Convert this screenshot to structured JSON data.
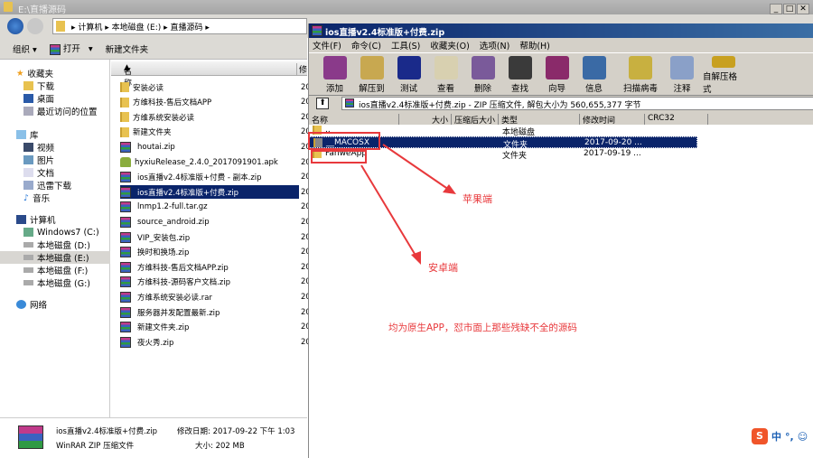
{
  "explorer": {
    "title": "E:\\直播源码",
    "breadcrumb": [
      "计算机",
      "本地磁盘 (E:)",
      "直播源码"
    ],
    "toolbar": {
      "organize": "组织",
      "open": "打开",
      "new_folder": "新建文件夹"
    },
    "sidebar": {
      "favorites": {
        "label": "收藏夹",
        "items": [
          "下载",
          "桌面",
          "最近访问的位置"
        ]
      },
      "libraries": {
        "label": "库",
        "items": [
          "视频",
          "图片",
          "文档",
          "迅雷下载",
          "音乐"
        ]
      },
      "computer": {
        "label": "计算机",
        "items": [
          "Windows7 (C:)",
          "本地磁盘 (D:)",
          "本地磁盘 (E:)",
          "本地磁盘 (F:)",
          "本地磁盘 (G:)"
        ]
      },
      "network": "网络"
    },
    "columns": {
      "name": "名称",
      "date": "修"
    },
    "files": [
      {
        "name": "安装必读",
        "type": "folder"
      },
      {
        "name": "方维科技-售后文档APP",
        "type": "folder"
      },
      {
        "name": "方维系统安装必读",
        "type": "folder"
      },
      {
        "name": "新建文件夹",
        "type": "folder"
      },
      {
        "name": "houtai.zip",
        "type": "rar"
      },
      {
        "name": "hyxiuRelease_2.4.0_2017091901.apk",
        "type": "apk"
      },
      {
        "name": "ios直播v2.4标准版+付费 - 副本.zip",
        "type": "rar"
      },
      {
        "name": "ios直播v2.4标准版+付费.zip",
        "type": "rar",
        "selected": true
      },
      {
        "name": "lnmp1.2-full.tar.gz",
        "type": "rar"
      },
      {
        "name": "source_android.zip",
        "type": "rar"
      },
      {
        "name": "VIP_安装包.zip",
        "type": "rar"
      },
      {
        "name": "换时和换场.zip",
        "type": "rar"
      },
      {
        "name": "方维科技-售后文档APP.zip",
        "type": "rar"
      },
      {
        "name": "方维科技-源码客户文档.zip",
        "type": "rar"
      },
      {
        "name": "方维系统安装必读.rar",
        "type": "rar"
      },
      {
        "name": "服务器并发配置最新.zip",
        "type": "rar"
      },
      {
        "name": "新建文件夹.zip",
        "type": "rar"
      },
      {
        "name": "夜火秀.zip",
        "type": "rar"
      }
    ],
    "date_prefix": "20",
    "details": {
      "name": "ios直播v2.4标准版+付费.zip",
      "modified_label": "修改日期:",
      "modified": "2017-09-22 下午 1:03",
      "type": "WinRAR ZIP 压缩文件",
      "size_label": "大小:",
      "size": "202 MB"
    }
  },
  "winrar": {
    "title": "ios直播v2.4标准版+付费.zip",
    "menu": [
      "文件(F)",
      "命令(C)",
      "工具(S)",
      "收藏夹(O)",
      "选项(N)",
      "帮助(H)"
    ],
    "toolbar": [
      {
        "label": "添加",
        "color": "#8a3a8a"
      },
      {
        "label": "解压到",
        "color": "#c8a850"
      },
      {
        "label": "测试",
        "color": "#1a2a8a"
      },
      {
        "label": "查看",
        "color": "#d8d0b0"
      },
      {
        "label": "删除",
        "color": "#7a5a9a"
      },
      {
        "label": "查找",
        "color": "#3a3a3a"
      },
      {
        "label": "向导",
        "color": "#8a2a6a"
      },
      {
        "label": "信息",
        "color": "#3a6aa5"
      },
      {
        "label": "扫描病毒",
        "color": "#c8b040"
      },
      {
        "label": "注释",
        "color": "#8aa0c8"
      },
      {
        "label": "自解压格式",
        "color": "#c8a020"
      }
    ],
    "path": "ios直播v2.4标准版+付费.zip - ZIP 压缩文件, 解包大小为 560,655,377 字节",
    "columns": [
      "名称",
      "大小",
      "压缩后大小",
      "类型",
      "修改时间",
      "CRC32"
    ],
    "rows": [
      {
        "name": "..",
        "type": "本地磁盘",
        "modified": ""
      },
      {
        "name": "__MACOSX",
        "type": "文件夹",
        "modified": "2017-09-20 ...",
        "selected": true
      },
      {
        "name": "FanweApp",
        "type": "文件夹",
        "modified": "2017-09-19 ..."
      }
    ]
  },
  "annotations": {
    "ios": "苹果端",
    "android": "安卓端",
    "note": "均为原生APP，怼市面上那些残缺不全的源码",
    "color": "#e8393c"
  },
  "ime": {
    "logo": "S",
    "lang": "中",
    "punct": "°,"
  }
}
